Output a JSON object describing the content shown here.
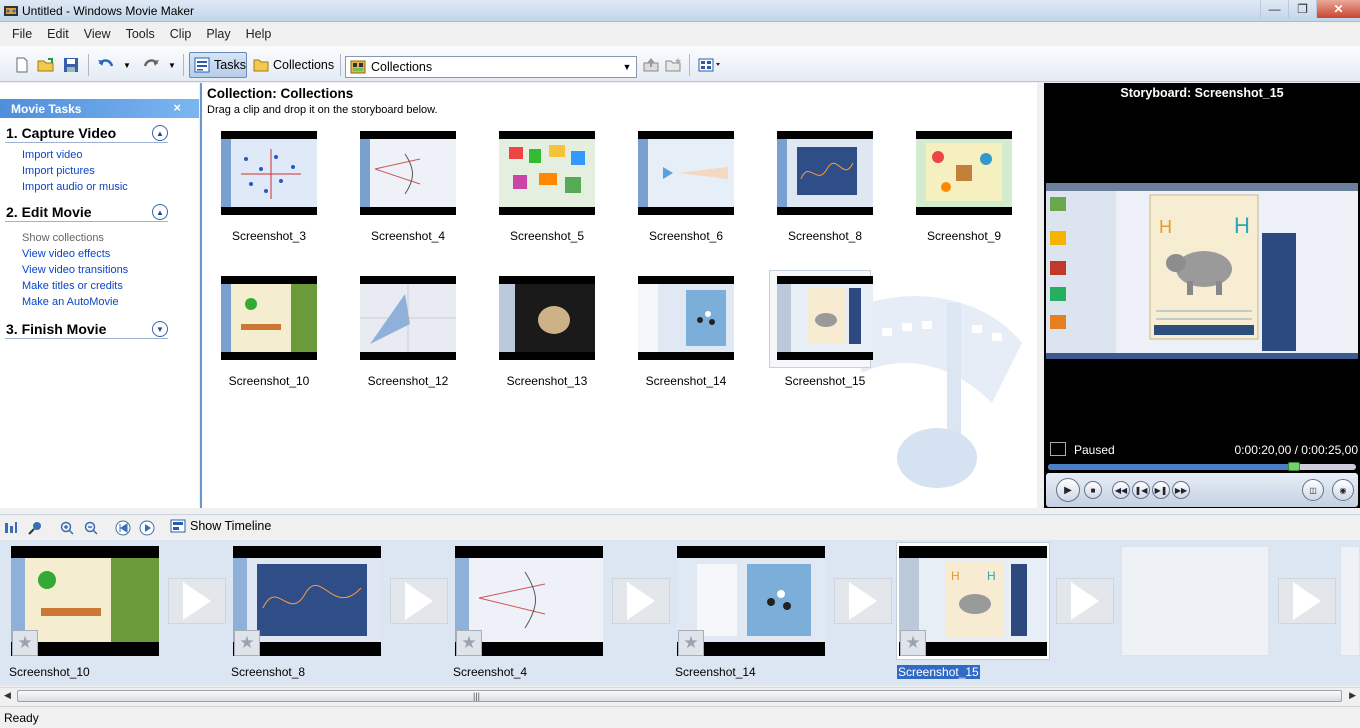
{
  "window": {
    "title": "Untitled - Windows Movie Maker"
  },
  "menu": [
    "File",
    "Edit",
    "View",
    "Tools",
    "Clip",
    "Play",
    "Help"
  ],
  "toolbar": {
    "tasks_label": "Tasks",
    "collections_label": "Collections",
    "collection_select_value": "Collections"
  },
  "taskpane": {
    "header": "Movie Tasks",
    "close": "×",
    "sections": [
      {
        "title": "1. Capture Video",
        "links": [
          "Import video",
          "Import pictures",
          "Import audio or music"
        ]
      },
      {
        "title": "2. Edit Movie",
        "links": [
          "Show collections",
          "View video effects",
          "View video transitions",
          "Make titles or credits",
          "Make an AutoMovie"
        ]
      },
      {
        "title": "3. Finish Movie",
        "links": []
      }
    ]
  },
  "collection": {
    "title": "Collection: Collections",
    "subtitle": "Drag a clip and drop it on the storyboard below.",
    "clips": [
      "Screenshot_3",
      "Screenshot_4",
      "Screenshot_5",
      "Screenshot_6",
      "Screenshot_8",
      "Screenshot_9",
      "Screenshot_10",
      "Screenshot_12",
      "Screenshot_13",
      "Screenshot_14",
      "Screenshot_15"
    ],
    "selected": "Screenshot_15"
  },
  "preview": {
    "title": "Storyboard: Screenshot_15",
    "status": "Paused",
    "time": "0:00:20,00 / 0:00:25,00",
    "progress": 0.8
  },
  "storyboard": {
    "show_timeline_label": "Show Timeline",
    "clips": [
      "Screenshot_10",
      "Screenshot_8",
      "Screenshot_4",
      "Screenshot_14",
      "Screenshot_15"
    ],
    "selected": "Screenshot_15"
  },
  "statusbar": {
    "text": "Ready"
  },
  "colors": {
    "accent": "#316ac5",
    "task_header": "#4f8edb",
    "link": "#0b45c6",
    "storyboard_bg": "#dce6f2"
  }
}
